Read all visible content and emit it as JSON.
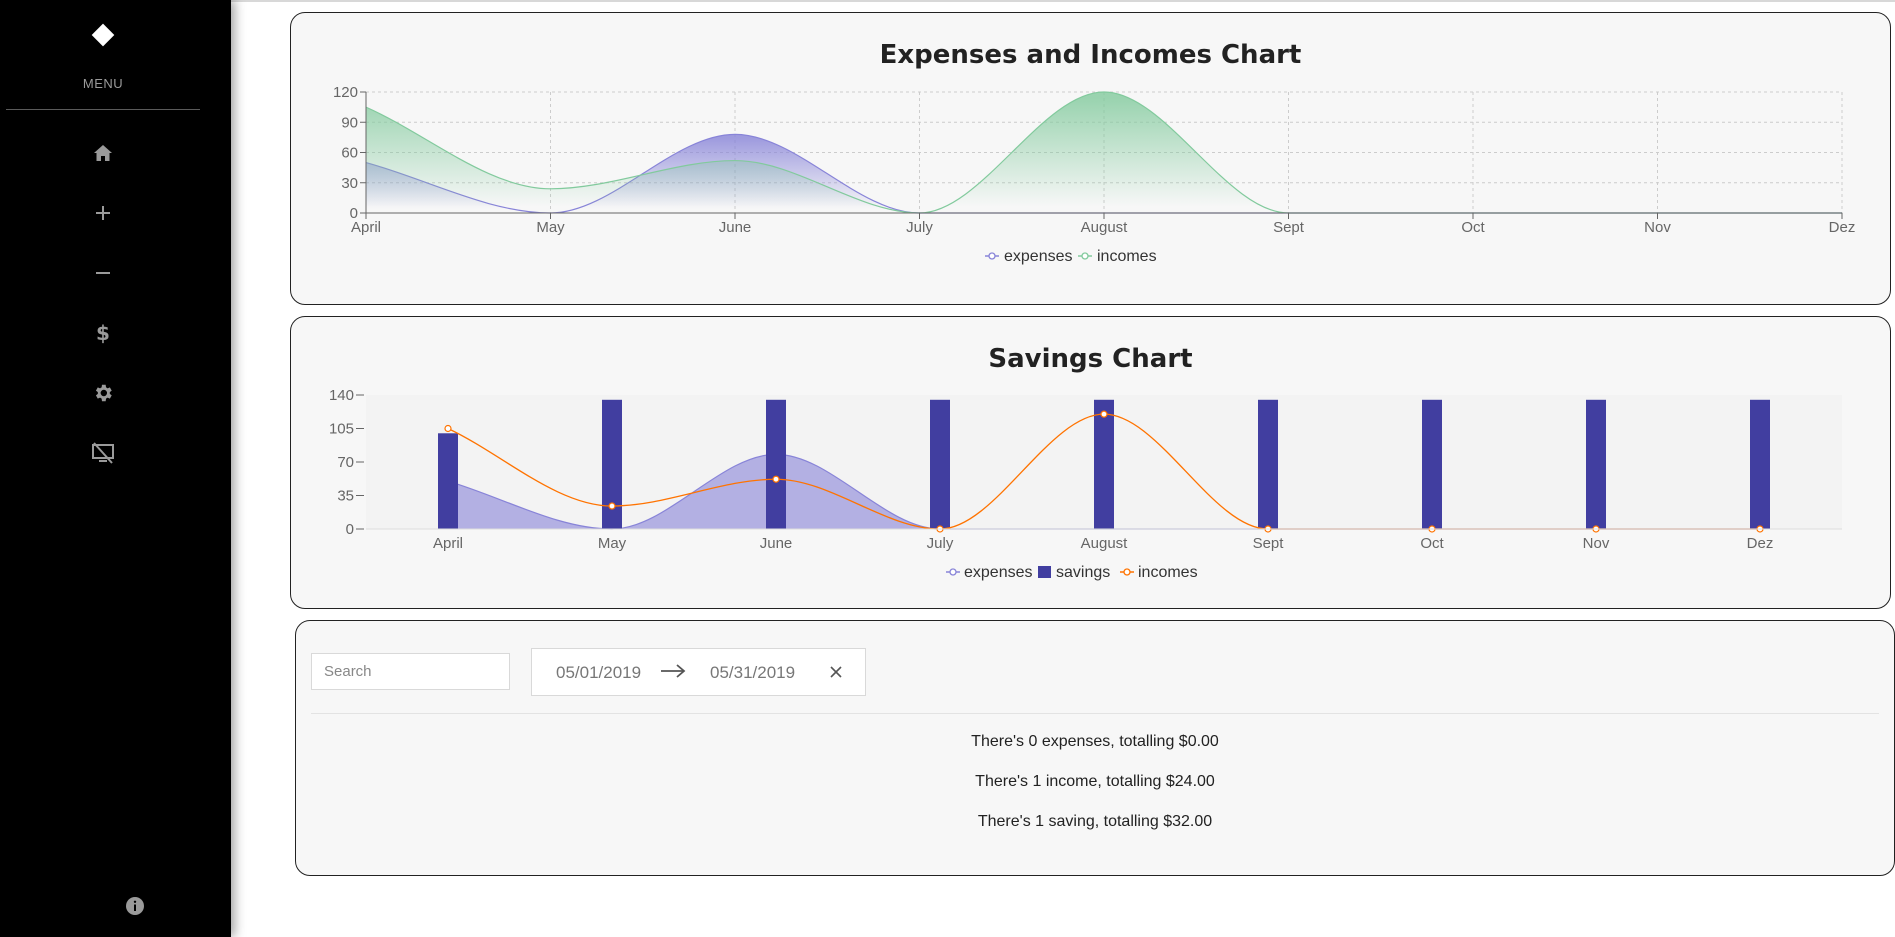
{
  "sidebar": {
    "menu_label": "MENU",
    "items": [
      {
        "icon": "home-icon"
      },
      {
        "icon": "plus-icon"
      },
      {
        "icon": "minus-icon"
      },
      {
        "icon": "dollar-icon"
      },
      {
        "icon": "gear-icon"
      },
      {
        "icon": "screen-off-icon"
      }
    ],
    "info_icon": "info-icon"
  },
  "expenses_chart": {
    "title": "Expenses and Incomes Chart",
    "legend": [
      "expenses",
      "incomes"
    ]
  },
  "savings_chart": {
    "title": "Savings Chart",
    "legend": [
      "expenses",
      "savings",
      "incomes"
    ]
  },
  "colors": {
    "expenses": "#8884d8",
    "incomes": "#82ca9d",
    "savings": "#413ea0",
    "incomes_line": "#ff7300"
  },
  "chart_data": [
    {
      "type": "area",
      "title": "Expenses and Incomes Chart",
      "categories": [
        "April",
        "May",
        "June",
        "July",
        "August",
        "Sept",
        "Oct",
        "Nov",
        "Dez"
      ],
      "series": [
        {
          "name": "expenses",
          "values": [
            50,
            0,
            78,
            0,
            0,
            0,
            0,
            0,
            0
          ]
        },
        {
          "name": "incomes",
          "values": [
            105,
            24,
            52,
            0,
            120,
            0,
            0,
            0,
            0
          ]
        }
      ],
      "yticks": [
        0,
        30,
        60,
        90,
        120
      ],
      "ylim": [
        0,
        120
      ],
      "grid": true,
      "legend_position": "bottom"
    },
    {
      "type": "bar",
      "title": "Savings Chart",
      "categories": [
        "April",
        "May",
        "June",
        "July",
        "August",
        "Sept",
        "Oct",
        "Nov",
        "Dez"
      ],
      "series": [
        {
          "name": "expenses",
          "type": "area",
          "values": [
            50,
            0,
            78,
            0,
            0,
            0,
            0,
            0,
            0
          ]
        },
        {
          "name": "savings",
          "type": "bar",
          "values": [
            100,
            135,
            135,
            135,
            135,
            135,
            135,
            135,
            135
          ]
        },
        {
          "name": "incomes",
          "type": "line",
          "values": [
            105,
            24,
            52,
            0,
            120,
            0,
            0,
            0,
            0
          ]
        }
      ],
      "yticks": [
        0,
        35,
        70,
        105,
        140
      ],
      "ylim": [
        0,
        140
      ],
      "grid": false,
      "legend_position": "bottom"
    }
  ],
  "filter": {
    "search_placeholder": "Search",
    "date_start": "05/01/2019",
    "date_end": "05/31/2019"
  },
  "summary": {
    "expenses_text": "There's 0 expenses, totalling $0.00",
    "income_text": "There's 1 income, totalling $24.00",
    "saving_text": "There's 1 saving, totalling $32.00"
  }
}
